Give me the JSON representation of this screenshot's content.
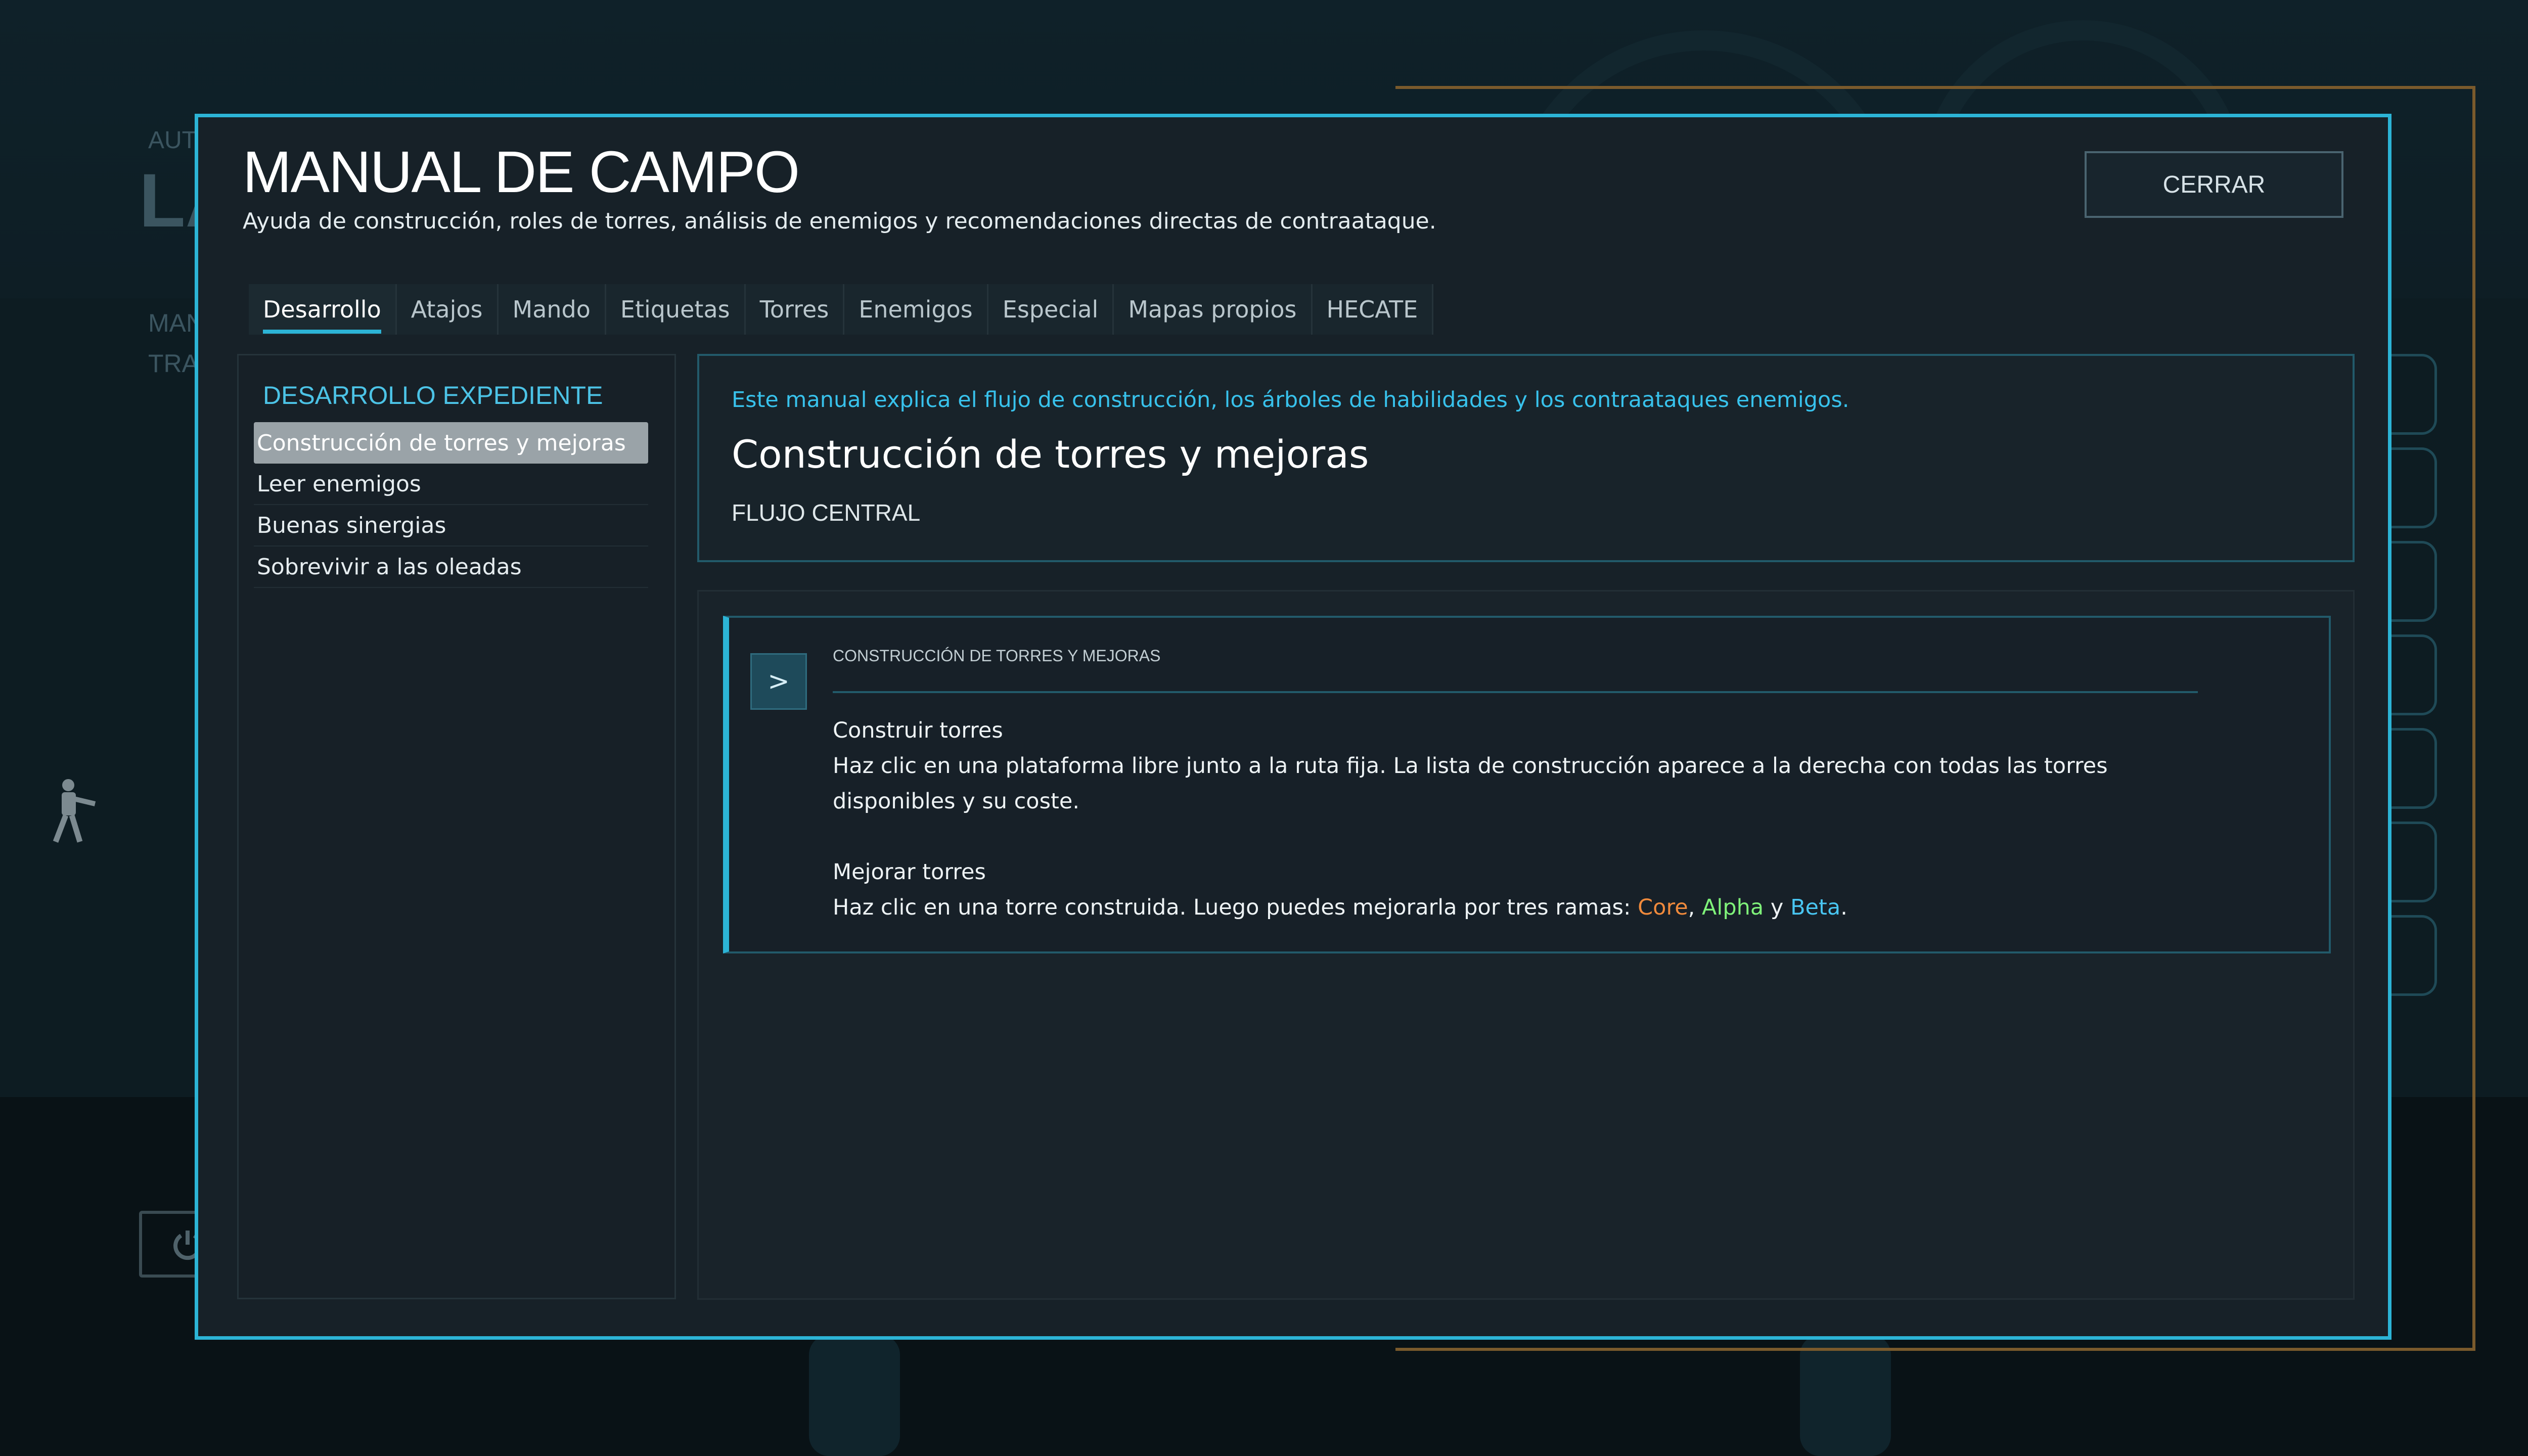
{
  "background": {
    "title_fragment": "AUT",
    "big_fragment": "LA",
    "label_a": "MAN",
    "label_b": "TRA"
  },
  "modal": {
    "title": "MANUAL DE CAMPO",
    "subtitle": "Ayuda de construcción, roles de torres, análisis de enemigos y recomendaciones directas de contraataque.",
    "close_label": "CERRAR"
  },
  "tabs": [
    {
      "label": "Desarrollo",
      "active": true
    },
    {
      "label": "Atajos",
      "active": false
    },
    {
      "label": "Mando",
      "active": false
    },
    {
      "label": "Etiquetas",
      "active": false
    },
    {
      "label": "Torres",
      "active": false
    },
    {
      "label": "Enemigos",
      "active": false
    },
    {
      "label": "Especial",
      "active": false
    },
    {
      "label": "Mapas propios",
      "active": false
    },
    {
      "label": "HECATE",
      "active": false
    }
  ],
  "sidebar": {
    "heading": "DESARROLLO EXPEDIENTE",
    "items": [
      {
        "label": "Construcción de torres y mejoras",
        "selected": true
      },
      {
        "label": "Leer enemigos",
        "selected": false
      },
      {
        "label": "Buenas sinergias",
        "selected": false
      },
      {
        "label": "Sobrevivir a las oleadas",
        "selected": false
      }
    ]
  },
  "intro": {
    "note": "Este manual explica el flujo de construcción, los árboles de habilidades y los contraataques enemigos.",
    "title": "Construcción de torres y mejoras",
    "tag": "FLUJO CENTRAL"
  },
  "card": {
    "icon": "chevron-right-icon",
    "icon_glyph": ">",
    "kicker": "CONSTRUCCIÓN DE TORRES Y MEJORAS",
    "section1_title": "Construir torres",
    "section1_text": "Haz clic en una plataforma libre junto a la ruta fija. La lista de construcción aparece a la derecha con todas las torres disponibles y su coste.",
    "section2_title": "Mejorar torres",
    "section2_text_prefix": "Haz clic en una torre construida. Luego puedes mejorarla por tres ramas: ",
    "branch_core": "Core",
    "sep1": ", ",
    "branch_alpha": "Alpha",
    "sep2": " y ",
    "branch_beta": "Beta",
    "end": "."
  },
  "colors": {
    "accent": "#2cb4d6",
    "core": "#f08a3c",
    "alpha": "#7ff27a",
    "beta": "#49c6f2"
  }
}
